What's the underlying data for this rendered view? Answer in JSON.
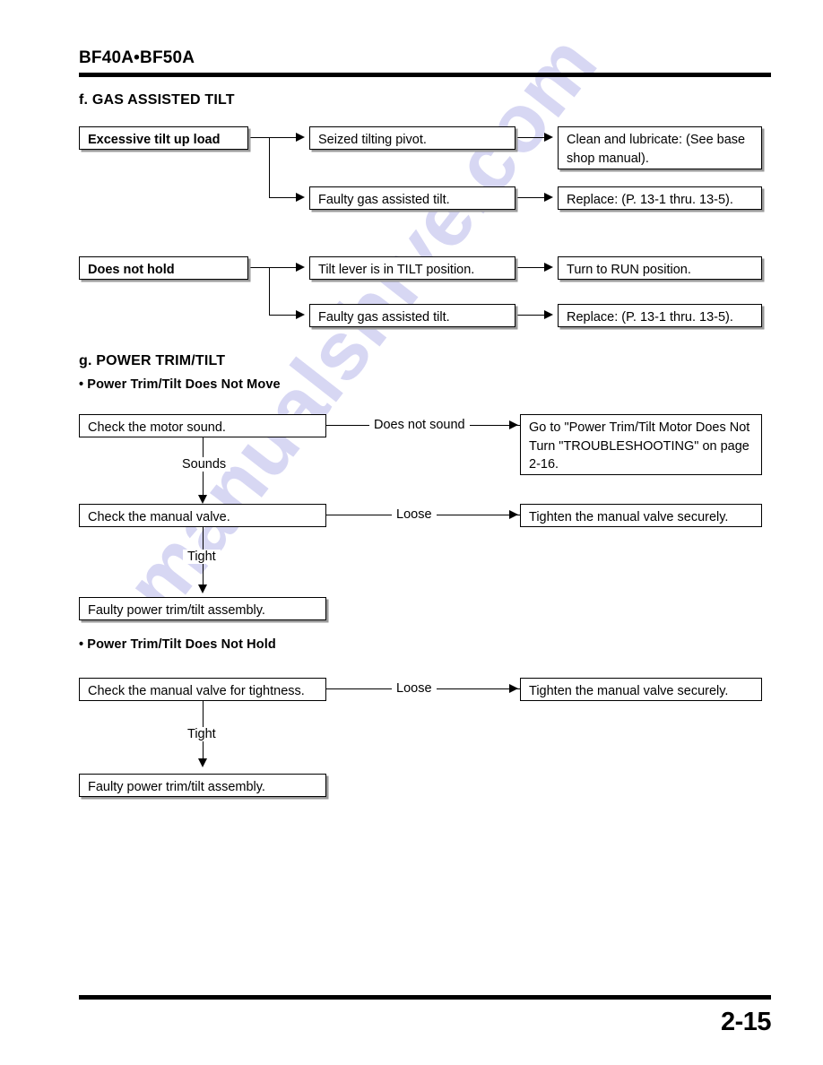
{
  "header": {
    "model_title": "BF40A•BF50A"
  },
  "watermark": {
    "text": "manualshive.com"
  },
  "sections": [
    {
      "heading": "f. GAS ASSISTED TILT",
      "charts": [
        {
          "symptom": "Excessive tilt up load",
          "branches": [
            {
              "cause": "Seized tilting pivot.",
              "remedy_line1": "Clean  and  lubricate:  (See  base",
              "remedy_line2": "shop manual)."
            },
            {
              "cause": "Faulty gas assisted tilt.",
              "remedy_line1": "Replace: (P. 13-1 thru. 13-5)."
            }
          ]
        },
        {
          "symptom": "Does not hold",
          "branches": [
            {
              "cause": "Tilt lever is in TILT position.",
              "remedy_line1": "Turn to RUN position."
            },
            {
              "cause": "Faulty gas assisted tilt.",
              "remedy_line1": "Replace: (P. 13-1 thru. 13-5)."
            }
          ]
        }
      ]
    },
    {
      "heading": "g. POWER TRIM/TILT",
      "subsections": [
        {
          "heading": "• Power Trim/Tilt Does Not Move",
          "steps": [
            {
              "check": "Check the motor sound.",
              "side_label": "Does not sound",
              "side_result_line1": "Go to \"Power Trim/Tilt Motor Does Not",
              "side_result_line2": "Turn \"TROUBLESHOOTING\" on page",
              "side_result_line3": "2-16.",
              "down_label": "Sounds"
            },
            {
              "check": "Check the manual valve.",
              "side_label": "Loose",
              "side_result_line1": "Tighten the manual valve securely.",
              "down_label": "Tight"
            },
            {
              "check": "Faulty power trim/tilt assembly."
            }
          ]
        },
        {
          "heading": "• Power Trim/Tilt Does Not Hold",
          "steps": [
            {
              "check": "Check the manual valve for tightness.",
              "side_label": "Loose",
              "side_result_line1": "Tighten the manual valve securely.",
              "down_label": "Tight"
            },
            {
              "check": "Faulty power trim/tilt assembly."
            }
          ]
        }
      ]
    }
  ],
  "footer": {
    "page_number": "2-15"
  }
}
